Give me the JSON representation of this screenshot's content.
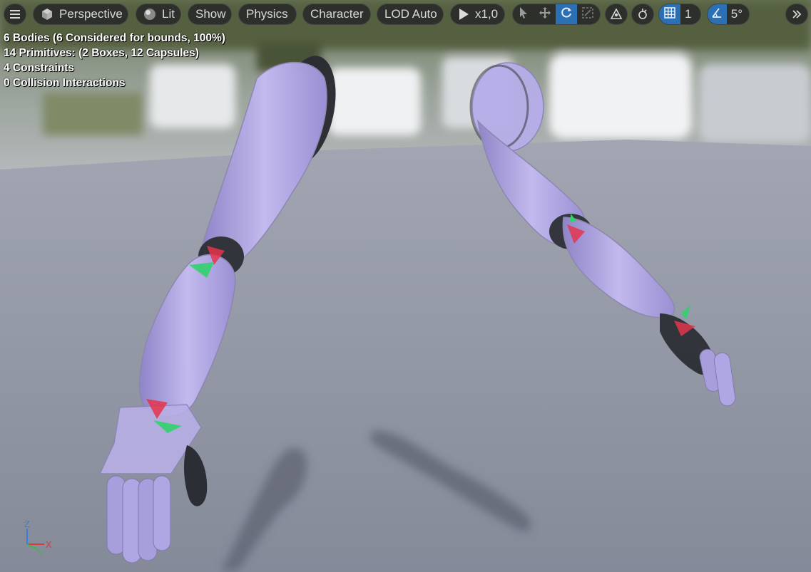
{
  "toolbar": {
    "menu_icon": "hamburger-menu-icon",
    "perspective_label": "Perspective",
    "lit_label": "Lit",
    "show_label": "Show",
    "physics_label": "Physics",
    "character_label": "Character",
    "lod_label": "LOD Auto",
    "play_speed_label": "x1,0",
    "grid_value": "1",
    "angle_value": "5°"
  },
  "stats": {
    "line1": "6 Bodies (6 Considered for bounds, 100%)",
    "line2": "14 Primitives: (2 Boxes, 12 Capsules)",
    "line3": "4 Constraints",
    "line4": "0 Collision Interactions"
  },
  "axis": {
    "z_label": "Z",
    "x_label": "X",
    "y_label": "Y"
  },
  "colors": {
    "accent": "#2b6fb5",
    "body_purple": "#a79be0",
    "floor": "#8b909e",
    "constraint_red": "#e8314a",
    "constraint_green": "#2fd36b"
  }
}
